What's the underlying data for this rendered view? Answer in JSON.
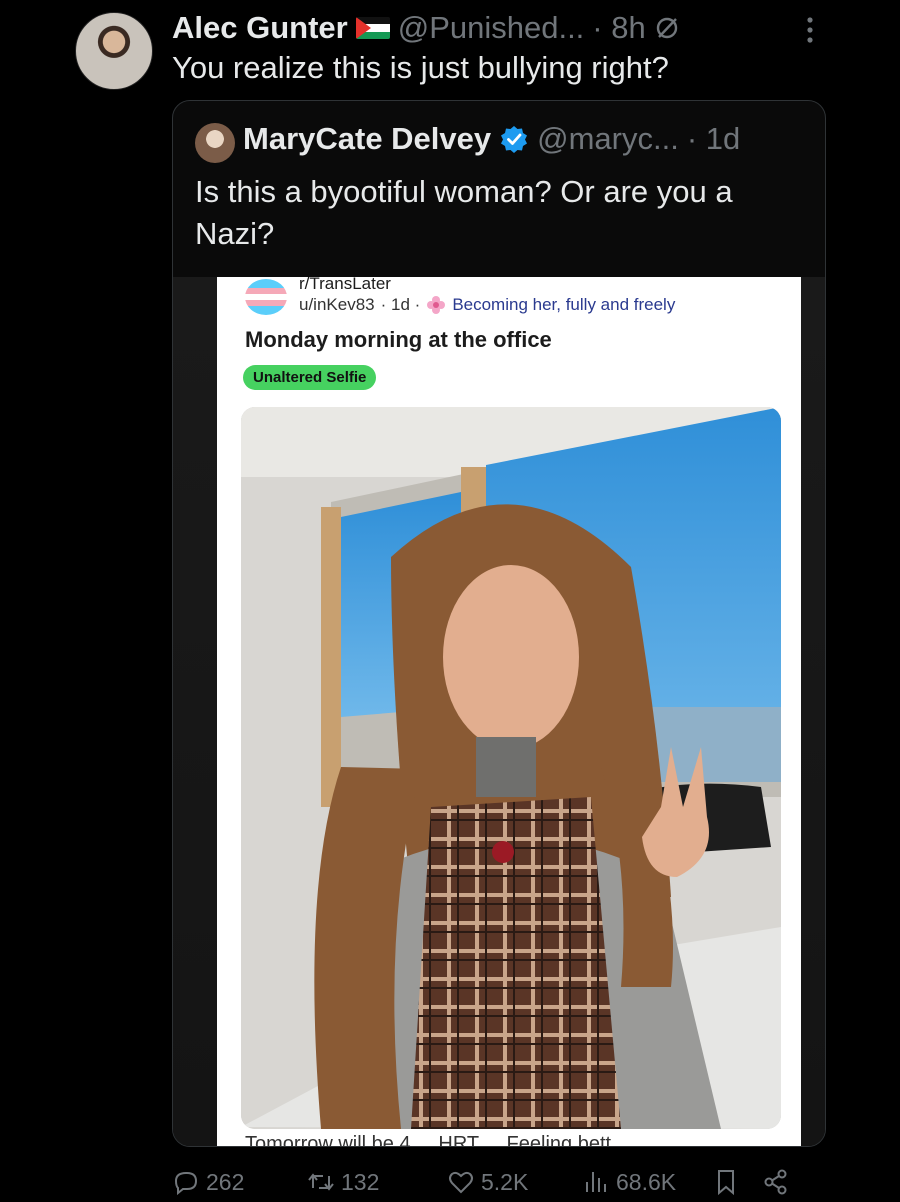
{
  "tweet": {
    "author_name": "Alec Gunter",
    "handle": "@Punished...",
    "time": "· 8h",
    "text": "You realize this is just bullying right?",
    "flag_icon": "palestine-flag-icon"
  },
  "quoted": {
    "author_name": "MaryCate Delvey",
    "handle": "@maryc...",
    "time": "· 1d",
    "text": "Is this a byootiful woman? Or are you a Nazi?",
    "verified": true
  },
  "reddit_card": {
    "subreddit": "r/TransLater",
    "user": "u/inKev83",
    "age": "· 1d ·",
    "flair": "Becoming her, fully and freely",
    "title": "Monday morning at the office",
    "tag": "Unaltered Selfie",
    "footer_peek": "Tomorrow will be 4 ... HRT ... Feeling bett..."
  },
  "actions": {
    "replies": "262",
    "reposts": "132",
    "likes": "5.2K",
    "views": "68.6K"
  },
  "colors": {
    "background": "#000000",
    "text": "#e7e9ea",
    "muted": "#71767b",
    "verified": "#1d9bf0",
    "tag_green": "#46d160"
  }
}
